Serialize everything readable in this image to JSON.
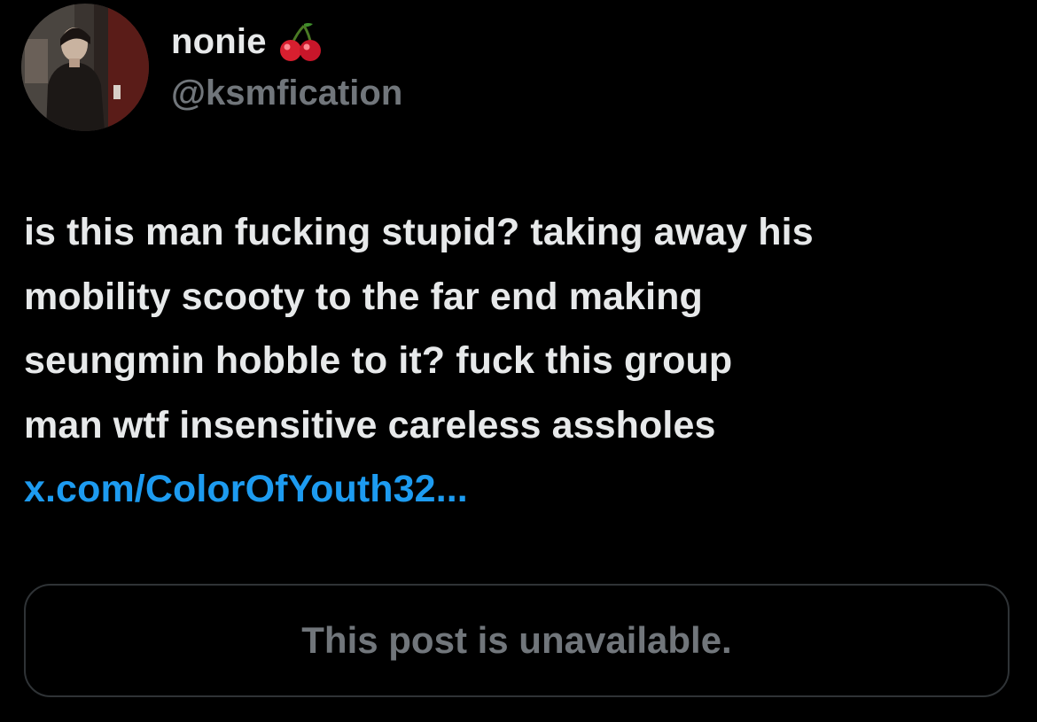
{
  "author": {
    "display_name": "nonie",
    "handle": "@ksmfication",
    "name_emoji_icon": "cherry-emoji-icon",
    "avatar_icon": "profile-photo-avatar"
  },
  "post": {
    "text_lines": [
      "is this man fucking stupid? taking away his",
      "mobility scooty to the far end making",
      "seungmin hobble to it? fuck this group",
      "man wtf insensitive careless assholes"
    ],
    "link_text": "x.com/ColorOfYouth32..."
  },
  "quoted_post": {
    "unavailable_text": "This post is unavailable."
  },
  "colors": {
    "background": "#000000",
    "primary_text": "#e7e9ea",
    "secondary_text": "#71767b",
    "link": "#1d9bf0",
    "border": "#2f3336"
  }
}
